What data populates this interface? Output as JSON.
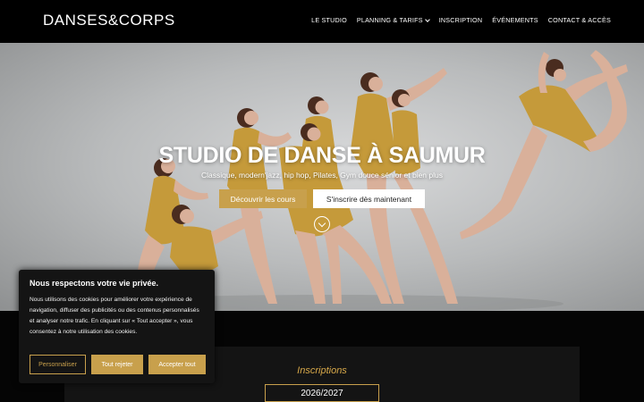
{
  "header": {
    "logo": "DANSES&CORPS",
    "nav": [
      {
        "label": "LE STUDIO"
      },
      {
        "label": "PLANNING & TARIFS"
      },
      {
        "label": "INSCRIPTION"
      },
      {
        "label": "ÉVÉNEMENTS"
      },
      {
        "label": "CONTACT & ACCÈS"
      }
    ]
  },
  "hero": {
    "title": "STUDIO DE DANSE À SAUMUR",
    "subtitle": "Classique, modern'jazz, hip hop, Pilates, Gym douce sénior et bien plus",
    "primary_button": "Découvrir les cours",
    "secondary_button": "S'inscrire dès maintenant"
  },
  "inscriptions": {
    "label": "Inscriptions",
    "year": "2026/2027"
  },
  "cookie": {
    "title": "Nous respectons votre vie privée.",
    "text": "Nous utilisons des cookies pour améliorer votre expérience de navigation, diffuser des publicités ou des contenus personnalisés et analyser notre trafic. En cliquant sur « Tout accepter », vous consentez à notre utilisation des cookies.",
    "buttons": {
      "customize": "Personnaliser",
      "reject": "Tout rejeter",
      "accept": "Accepter tout"
    }
  },
  "colors": {
    "accent": "#c8a04c",
    "header_bg": "#000000",
    "panel_bg": "#141414"
  }
}
